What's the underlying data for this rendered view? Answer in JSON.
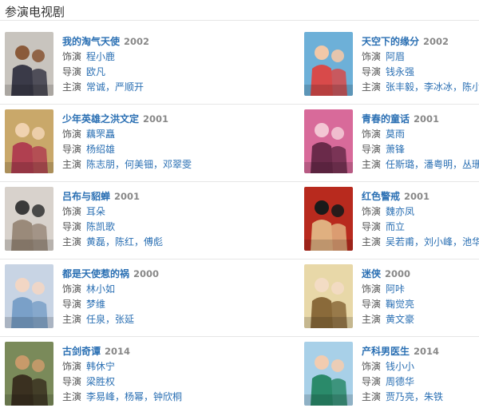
{
  "section": {
    "title": "参演电视剧"
  },
  "labels": {
    "role": "饰演",
    "director": "导演",
    "cast": "主演"
  },
  "posters": {
    "0": {
      "bg": "#c8c4be",
      "a": "#8a5a3a",
      "b": "#3a3a48"
    },
    "1": {
      "bg": "#6db0d8",
      "a": "#f2c8a8",
      "b": "#d84a4a"
    },
    "2": {
      "bg": "#c9a86a",
      "a": "#f0d2b0",
      "b": "#b04050"
    },
    "3": {
      "bg": "#d86a9a",
      "a": "#f3c6d4",
      "b": "#6a2a4a"
    },
    "4": {
      "bg": "#d8d2cc",
      "a": "#3a3a3a",
      "b": "#9a8a7a"
    },
    "5": {
      "bg": "#b82a1e",
      "a": "#1a1a1a",
      "b": "#e0b080"
    },
    "6": {
      "bg": "#c8d4e4",
      "a": "#f2d6c4",
      "b": "#7aa0c8"
    },
    "7": {
      "bg": "#e8d8a8",
      "a": "#f3dcc4",
      "b": "#8a6a3a"
    },
    "8": {
      "bg": "#7a8a5a",
      "a": "#c89a6a",
      "b": "#3a3020"
    },
    "9": {
      "bg": "#a8d0e8",
      "a": "#f2ccb0",
      "b": "#2a8a6a"
    }
  },
  "dramas": [
    {
      "title": "我的淘气天使",
      "year": "2002",
      "role": "程小鹿",
      "director": "欧凡",
      "cast": "常诚，严顺开"
    },
    {
      "title": "天空下的缘分",
      "year": "2002",
      "role": "阿眉",
      "director": "钱永强",
      "cast": "张丰毅，李冰冰，陈小春"
    },
    {
      "title": "少年英雄之洪文定",
      "year": "2001",
      "role": "藕罘矗",
      "director": "杨绍雄",
      "cast": "陈志朋，何美钿，邓翠雯"
    },
    {
      "title": "青春的童话",
      "year": "2001",
      "role": "莫雨",
      "director": "萧锋",
      "cast": "任斯璐，潘粤明，丛珊"
    },
    {
      "title": "吕布与貂蝉",
      "year": "2001",
      "role": "耳朵",
      "director": "陈凯歌",
      "cast": "黄磊，陈红，傅彪"
    },
    {
      "title": "红色警戒",
      "year": "2001",
      "role": "魏亦凤",
      "director": "而立",
      "cast": "吴若甫，刘小峰，池华琼"
    },
    {
      "title": "都是天使惹的祸",
      "year": "2000",
      "role": "林小如",
      "director": "梦维",
      "cast": "任泉，张延"
    },
    {
      "title": "迷侠",
      "year": "2000",
      "role": "阿咔",
      "director": "鞠觉亮",
      "cast": "黄文豪"
    },
    {
      "title": "古剑奇谭",
      "year": "2014",
      "role": "韩休宁",
      "director": "梁胜权",
      "cast": "李易峰，杨幂，钟欣桐"
    },
    {
      "title": "产科男医生",
      "year": "2014",
      "role": "钱小小",
      "director": "周德华",
      "cast": "贾乃亮，朱铁"
    }
  ]
}
